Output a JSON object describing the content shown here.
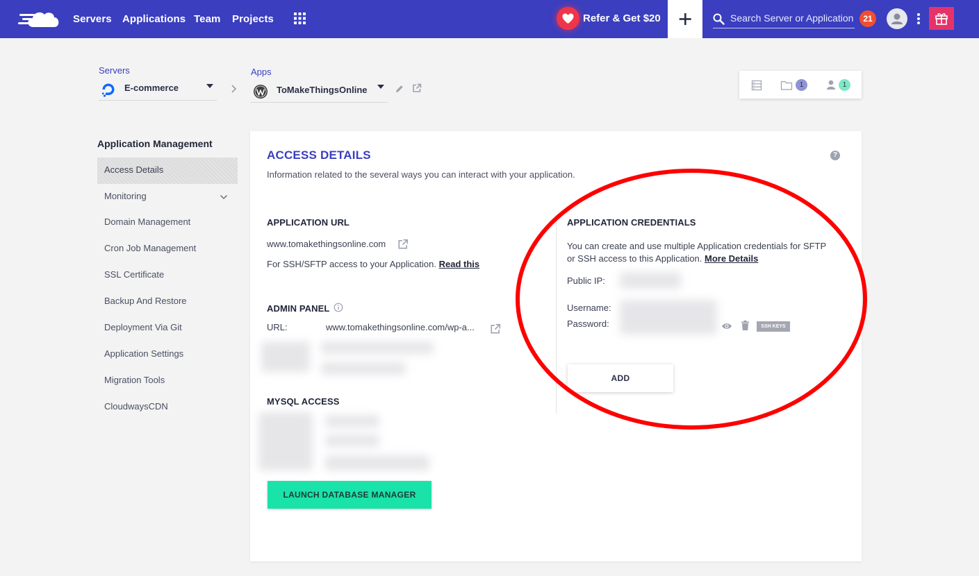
{
  "topbar": {
    "nav": [
      "Servers",
      "Applications",
      "Team",
      "Projects"
    ],
    "refer_label": "Refer & Get $20",
    "search_placeholder": "Search Server or Application",
    "notification_count": "21"
  },
  "breadcrumb": {
    "servers_label": "Servers",
    "server_name": "E-commerce",
    "apps_label": "Apps",
    "app_name": "ToMakeThingsOnline"
  },
  "stats": {
    "files_count": "1",
    "members_count": "1"
  },
  "sidebar": {
    "title": "Application Management",
    "items": [
      "Access Details",
      "Monitoring",
      "Domain Management",
      "Cron Job Management",
      "SSL Certificate",
      "Backup And Restore",
      "Deployment Via Git",
      "Application Settings",
      "Migration Tools",
      "CloudwaysCDN"
    ]
  },
  "access": {
    "title": "ACCESS DETAILS",
    "subtitle": "Information related to the several ways you can interact with your application.",
    "app_url_heading": "APPLICATION URL",
    "app_url": "www.tomakethingsonline.com",
    "ssh_note": "For SSH/SFTP access to your Application.",
    "ssh_link": "Read this",
    "admin_heading": "ADMIN PANEL",
    "admin_url_label": "URL:",
    "admin_url": "www.tomakethingsonline.com/wp-a...",
    "mysql_heading": "MYSQL ACCESS",
    "db_button": "LAUNCH DATABASE MANAGER"
  },
  "credentials": {
    "heading": "APPLICATION CREDENTIALS",
    "desc_line1": "You can create and use multiple Application credentials for SFTP",
    "desc_line2": "or SSH access to this Application.",
    "more_link": "More Details",
    "public_ip_label": "Public IP:",
    "username_label": "Username:",
    "password_label": "Password:",
    "ssh_keys_label": "SSH KEYS",
    "add_button": "ADD"
  },
  "colors": {
    "topbar": "#3a3ebf",
    "accent": "#3a3ebf",
    "db_button": "#19e3a8",
    "notif": "#f04f33",
    "gift": "#e5336a",
    "annotation": "#ff0000"
  }
}
